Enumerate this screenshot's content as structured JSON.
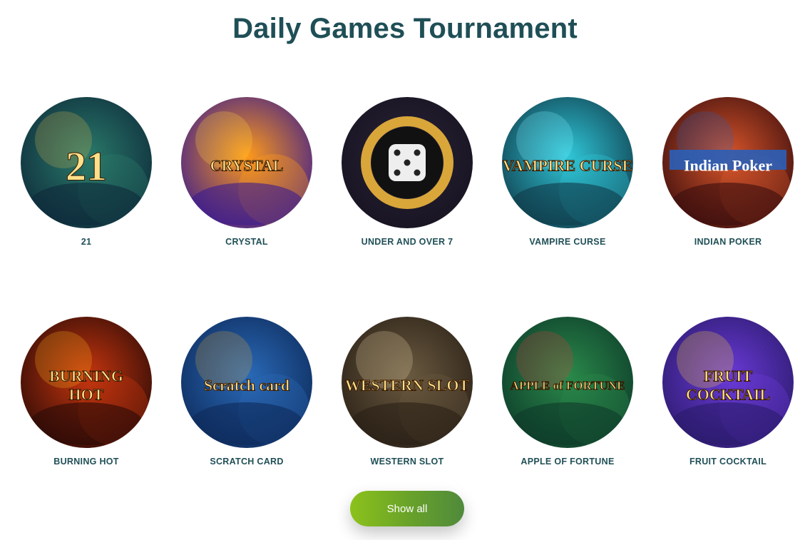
{
  "header": {
    "title": "Daily Games Tournament"
  },
  "games": [
    {
      "name": "21",
      "art_text": "21",
      "icon": "blackjack-icon",
      "colors": [
        "#0d2a3a",
        "#2a7a6a",
        "#d9b34a"
      ]
    },
    {
      "name": "CRYSTAL",
      "art_text": "CRYSTAL",
      "icon": "treasure-chest-icon",
      "colors": [
        "#3a1b8f",
        "#ff9a1a",
        "#ffd23a"
      ]
    },
    {
      "name": "UNDER AND OVER 7",
      "art_text": "",
      "icon": "dice-icon",
      "colors": [
        "#16121f",
        "#2a2438",
        "#d9a63a"
      ]
    },
    {
      "name": "VAMPIRE CURSE",
      "art_text": "VAMPIRE CURSE",
      "icon": "vampire-icon",
      "colors": [
        "#0f3b4a",
        "#2fc7d8",
        "#7ef0ff"
      ]
    },
    {
      "name": "INDIAN POKER",
      "art_text": "Indian Poker",
      "icon": "cards-icon",
      "colors": [
        "#3a0d0d",
        "#d8552a",
        "#2a5fb8"
      ]
    },
    {
      "name": "BURNING HOT",
      "art_text": "BURNING HOT",
      "icon": "fire-icon",
      "colors": [
        "#2a0a06",
        "#c8360f",
        "#ffb31a"
      ]
    },
    {
      "name": "SCRATCH CARD",
      "art_text": "Scratch card",
      "icon": "tiger-icon",
      "colors": [
        "#0d2a5a",
        "#2a6ab8",
        "#d8a43a"
      ]
    },
    {
      "name": "WESTERN SLOT",
      "art_text": "WESTERN SLOT",
      "icon": "cowboy-icon",
      "colors": [
        "#2a2016",
        "#6a5a40",
        "#e8d4a8"
      ]
    },
    {
      "name": "APPLE OF FORTUNE",
      "art_text": "APPLE of FORTUNE",
      "icon": "apple-icon",
      "colors": [
        "#0d3a2a",
        "#2a8a4a",
        "#d83a3a"
      ]
    },
    {
      "name": "FRUIT COCKTAIL",
      "art_text": "FRUIT COCKTAIL",
      "icon": "fruit-icon",
      "colors": [
        "#2a1a6a",
        "#6a3ad8",
        "#ffd23a"
      ]
    }
  ],
  "actions": {
    "show_all_label": "Show all"
  }
}
